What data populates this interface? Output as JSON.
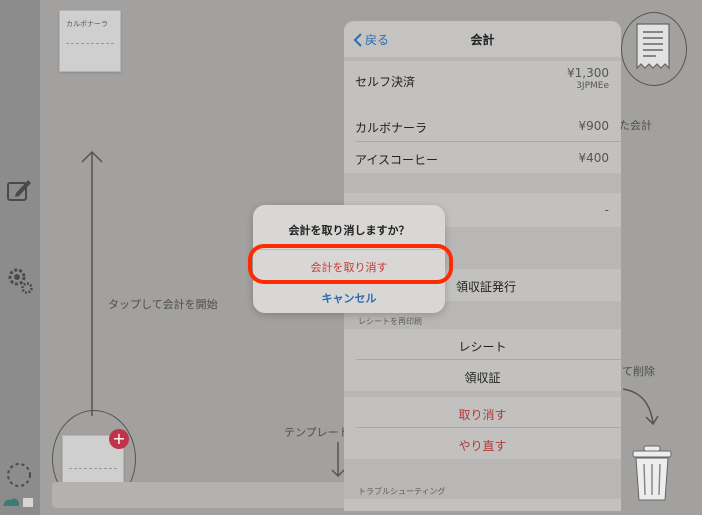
{
  "canvas": {
    "ticket_top_label": "カルボナーラ",
    "start_hint": "タップして会計を開始",
    "template_hint": "テンプレート",
    "history_hint": "た会計",
    "delete_hint": "て削除",
    "add_glyph": "+"
  },
  "sheet": {
    "back_label": "戻る",
    "title": "会計",
    "payment_row": {
      "label": "セルフ決済",
      "amount": "¥1,300",
      "code": "3JPMEe"
    },
    "items": [
      {
        "label": "カルボナーラ",
        "price": "¥900"
      },
      {
        "label": "アイスコーヒー",
        "price": "¥400"
      }
    ],
    "dash_value": "-",
    "receipt_issue_label": "領収証発行",
    "reprint_section": "レシートを再印刷",
    "reprint_receipt": "レシート",
    "reprint_invoice": "領収証",
    "cancel_action": "取り消す",
    "redo_action": "やり直す",
    "troubleshooting_section": "トラブルシューティング"
  },
  "alert": {
    "title": "会計を取り消しますか？",
    "confirm_label": "会計を取り消す",
    "cancel_label": "キャンセル"
  },
  "colors": {
    "accent_blue": "#2d6ab0",
    "destructive_red": "#c43a3a",
    "highlight": "#ff2b00",
    "add_badge": "#c1334a"
  }
}
